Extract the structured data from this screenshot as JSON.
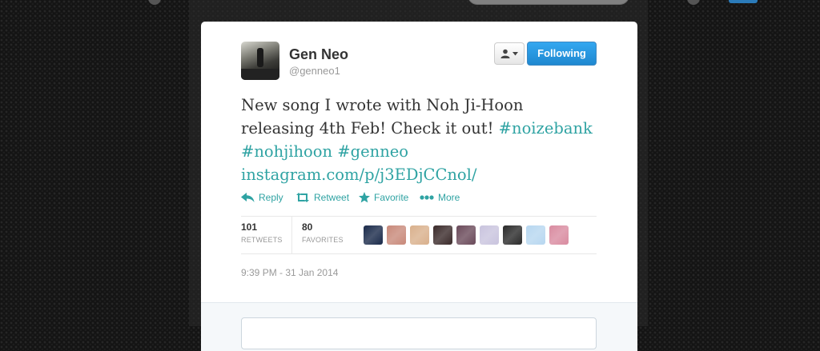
{
  "user": {
    "name": "Gen Neo",
    "handle": "@genneo1"
  },
  "follow_button": {
    "label": "Following"
  },
  "tweet": {
    "text_plain": "New song I wrote with Noh Ji-Hoon releasing 4th Feb! Check it out! ",
    "hashtag_1": "#noizebank",
    "hashtag_2": "#nohjihoon",
    "hashtag_3": "#genneo",
    "link": "instagram.com/p/j3EDjCCnol/"
  },
  "actions": {
    "reply": "Reply",
    "retweet": "Retweet",
    "favorite": "Favorite",
    "more": "More"
  },
  "stats": {
    "retweets_count": "101",
    "retweets_label": "RETWEETS",
    "favorites_count": "80",
    "favorites_label": "FAVORITES"
  },
  "favoriters": [
    "#1a2a4a",
    "#c8897a",
    "#d9b08c",
    "#3a2a2a",
    "#6a4a5a",
    "#c9c4de",
    "#2a2a2a",
    "#b7d7f0",
    "#d98ba0"
  ],
  "timestamp": "9:39 PM - 31 Jan 2014",
  "colors": {
    "link": "#2fa3a3",
    "follow_button": "#1f88d0",
    "background": "#141414"
  }
}
